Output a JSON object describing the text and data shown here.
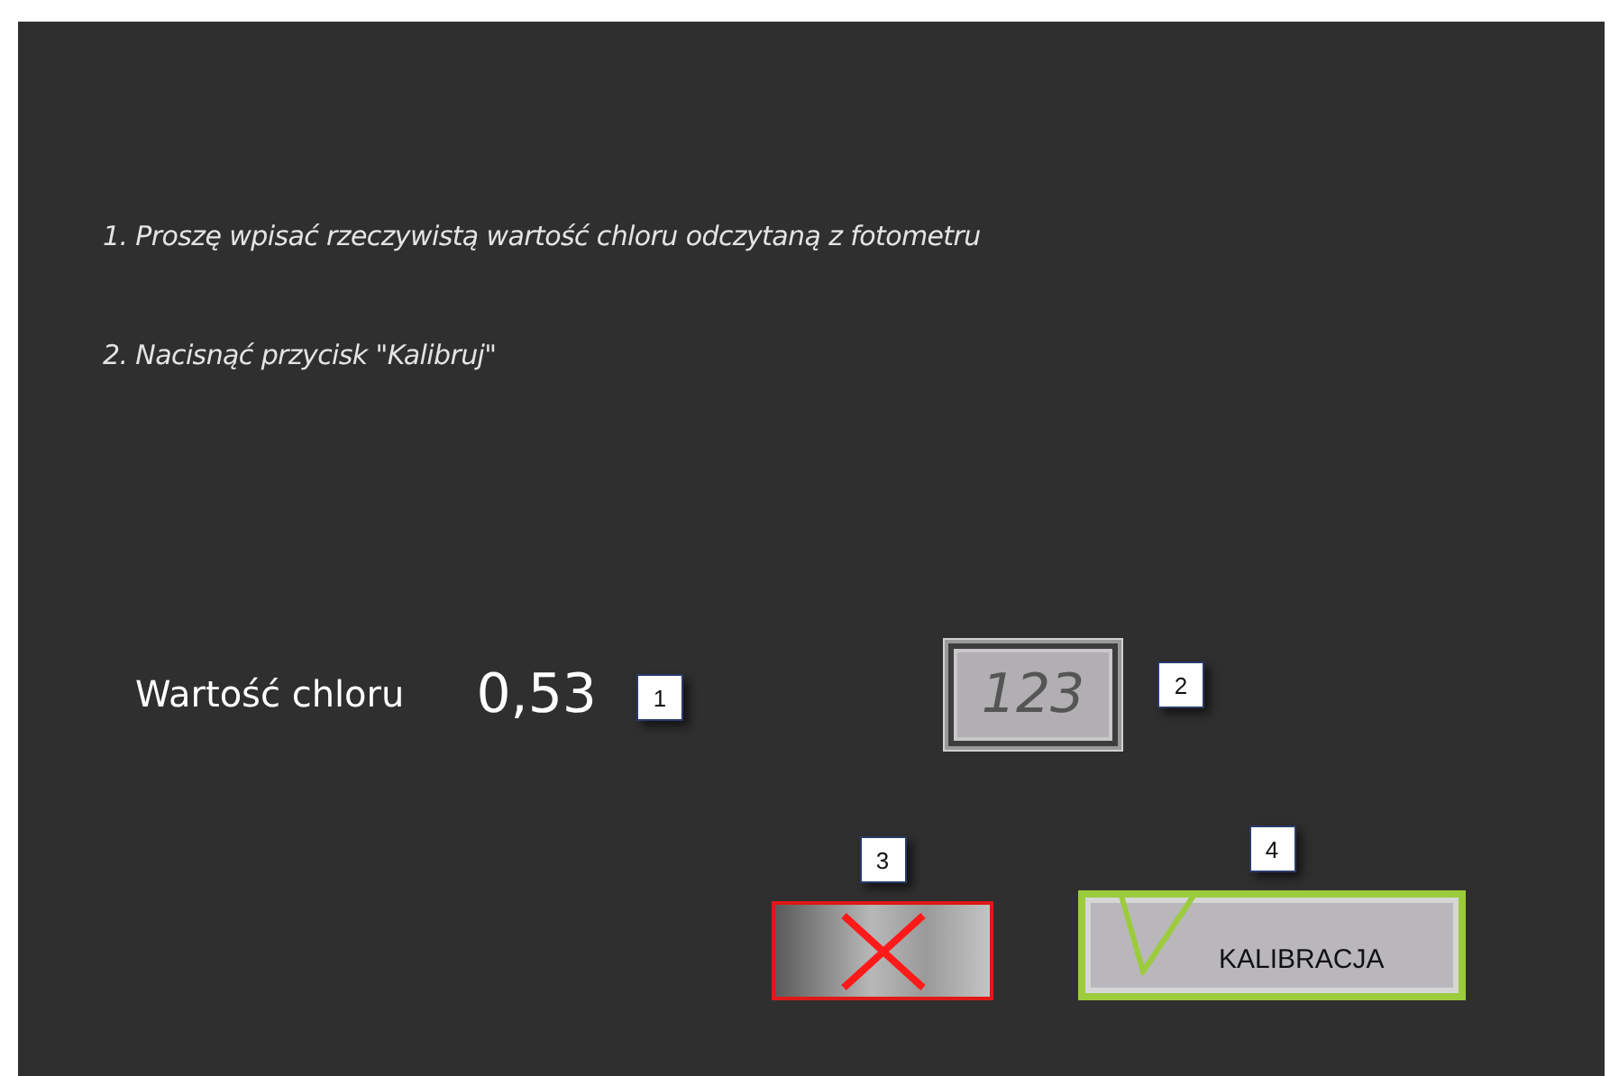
{
  "instructions": [
    "1. Proszę wpisać rzeczywistą wartość chloru odczytaną z fotometru",
    "2. Nacisnąć przycisk \"Kalibruj\""
  ],
  "chlorine": {
    "label": "Wartość chloru",
    "value": "0,53",
    "badge": "1"
  },
  "keypad_button": {
    "label": "123",
    "badge": "2"
  },
  "cancel_button": {
    "badge": "3"
  },
  "calibrate_button": {
    "label": "KALIBRACJA",
    "badge": "4"
  }
}
